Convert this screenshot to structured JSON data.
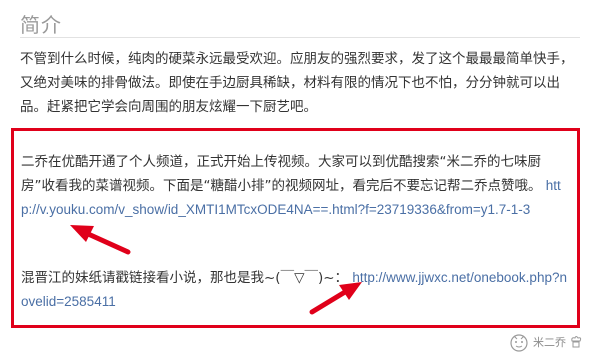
{
  "section": {
    "title": "简介"
  },
  "intro": {
    "text": "不管到什么时候，纯肉的硬菜永远最受欢迎。应朋友的强烈要求，发了这个最最最简单快手，又绝对美味的排骨做法。即使在手边厨具稀缺，材料有限的情况下也不怕，分分钟就可以出品。赶紧把它学会向周围的朋友炫耀一下厨艺吧。"
  },
  "highlight": {
    "para1_text": "二乔在优酷开通了个人频道，正式开始上传视频。大家可以到优酷搜索“米二乔的七味厨房”收看我的菜谱视频。下面是“糖醋小排”的视频网址，看完后不要忘记帮二乔点赞哦。",
    "para1_link": "http://v.youku.com/v_show/id_XMTI1MTcxODE4NA==.html?f=23719336&from=y1.7-1-3",
    "para2_text": "混晋江的妹纸请戳链接看小说，那也是我~(￣▽￣)~：",
    "para2_link": "http://www.jjwxc.net/onebook.php?novelid=2585411"
  },
  "watermark": {
    "text": "米二乔"
  },
  "colors": {
    "box_border": "#e0001a",
    "arrow": "#e0001a",
    "link": "#4a6fa5",
    "title": "#9a9a9a"
  }
}
